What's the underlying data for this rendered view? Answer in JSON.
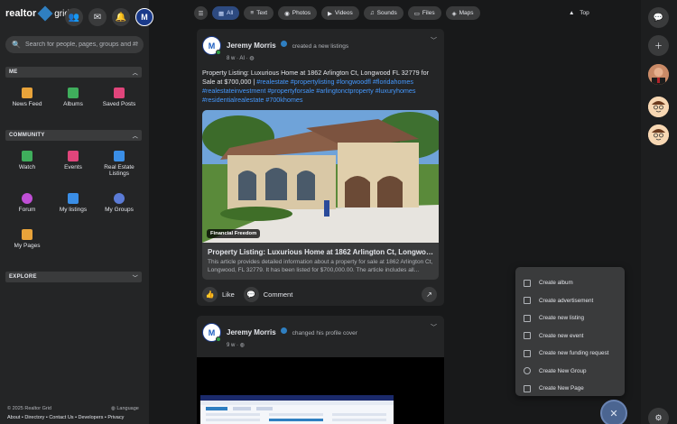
{
  "brand": {
    "name": "realtor",
    "sub": "grid"
  },
  "search": {
    "placeholder": "Search for people, pages, groups and #ha"
  },
  "sidebar": {
    "me_header": "ME",
    "community_header": "COMMUNITY",
    "explore_header": "EXPLORE",
    "me_items": [
      {
        "label": "News Feed",
        "color": "#e8a33a"
      },
      {
        "label": "Albums",
        "color": "#3fae5c"
      },
      {
        "label": "Saved Posts",
        "color": "#e0457b"
      }
    ],
    "community_items": [
      {
        "label": "Watch",
        "color": "#3fae5c"
      },
      {
        "label": "Events",
        "color": "#e0457b"
      },
      {
        "label": "Real Estate Listings",
        "color": "#3a8ee6"
      },
      {
        "label": "Forum",
        "color": "#c04fd6"
      },
      {
        "label": "My listings",
        "color": "#3a8ee6"
      },
      {
        "label": "My Groups",
        "color": "#5b7bd6"
      },
      {
        "label": "My Pages",
        "color": "#e8a33a"
      }
    ]
  },
  "footer": {
    "copyright": "© 2025 Realtor Grid",
    "language": "Language",
    "links": "About • Directory • Contact Us • Developers • Privacy"
  },
  "filters": {
    "items": [
      {
        "label": "All",
        "active": true
      },
      {
        "label": "Text",
        "active": false
      },
      {
        "label": "Photos",
        "active": false
      },
      {
        "label": "Videos",
        "active": false
      },
      {
        "label": "Sounds",
        "active": false
      },
      {
        "label": "Files",
        "active": false
      },
      {
        "label": "Maps",
        "active": false
      }
    ],
    "top_label": "Top"
  },
  "posts": [
    {
      "author": "Jeremy Morris",
      "action": "created a new listings",
      "meta": "8 w · AI ·",
      "text_plain": "Property Listing: Luxurious Home at 1862 Arlington Ct, Longwood FL 32779 for Sale at $700,000 | ",
      "hashtags": "#realestate #propertylisting #longwoodfl #floridahomes #realestateinvestment #propertyforsale #arlingtonctproperty #luxuryhomes #residentialrealestate #700khomes",
      "card": {
        "badge": "Financial Freedom",
        "title": "Property Listing: Luxurious Home at 1862 Arlington Ct, Longwood F...",
        "desc": "This article provides detailed information about a property for sale at 1862 Arlington Ct, Longwood, FL 32779. It has been listed for $700,000.00. The article includes all..."
      },
      "like_label": "Like",
      "comment_label": "Comment"
    },
    {
      "author": "Jeremy Morris",
      "action": "changed his profile cover",
      "meta": "9 w ·"
    }
  ],
  "create_menu": {
    "items": [
      "Create album",
      "Create advertisement",
      "Create new listing",
      "Create new event",
      "Create new funding request",
      "Create New Group",
      "Create New Page"
    ]
  },
  "colors": {
    "accent": "#2f7fc1",
    "hashtag": "#4599ff",
    "online": "#31a24c"
  }
}
